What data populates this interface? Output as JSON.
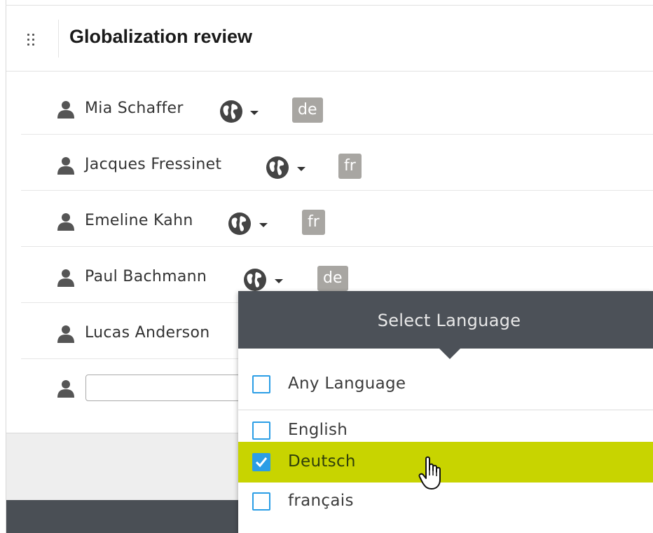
{
  "header": {
    "title": "Globalization review"
  },
  "assignees": [
    {
      "name": "Mia Schaffer",
      "language_badge": "de"
    },
    {
      "name": "Jacques Fressinet",
      "language_badge": "fr"
    },
    {
      "name": "Emeline Kahn",
      "language_badge": "fr"
    },
    {
      "name": "Paul Bachmann",
      "language_badge": "de"
    },
    {
      "name": "Lucas Anderson",
      "language_badge": ""
    }
  ],
  "new_assignee": {
    "value": "",
    "placeholder": ""
  },
  "language_dropdown": {
    "title": "Select Language",
    "options": [
      {
        "label": "Any Language",
        "checked": false
      },
      {
        "label": "English",
        "checked": false
      },
      {
        "label": "Deutsch",
        "checked": true,
        "highlighted": true
      },
      {
        "label": "français",
        "checked": false
      }
    ]
  },
  "colors": {
    "badge": "#a8a6a2",
    "dropdown_header": "#4c5158",
    "highlight": "#c8d400",
    "checkbox": "#2b9ee6",
    "footer_dark": "#4a4f55"
  },
  "icons": {
    "drag": "drag-handle-icon",
    "person": "person-icon",
    "globe": "globe-icon",
    "caret": "caret-down-icon",
    "check": "checkmark-icon",
    "cursor": "hand-pointer-cursor-icon"
  }
}
